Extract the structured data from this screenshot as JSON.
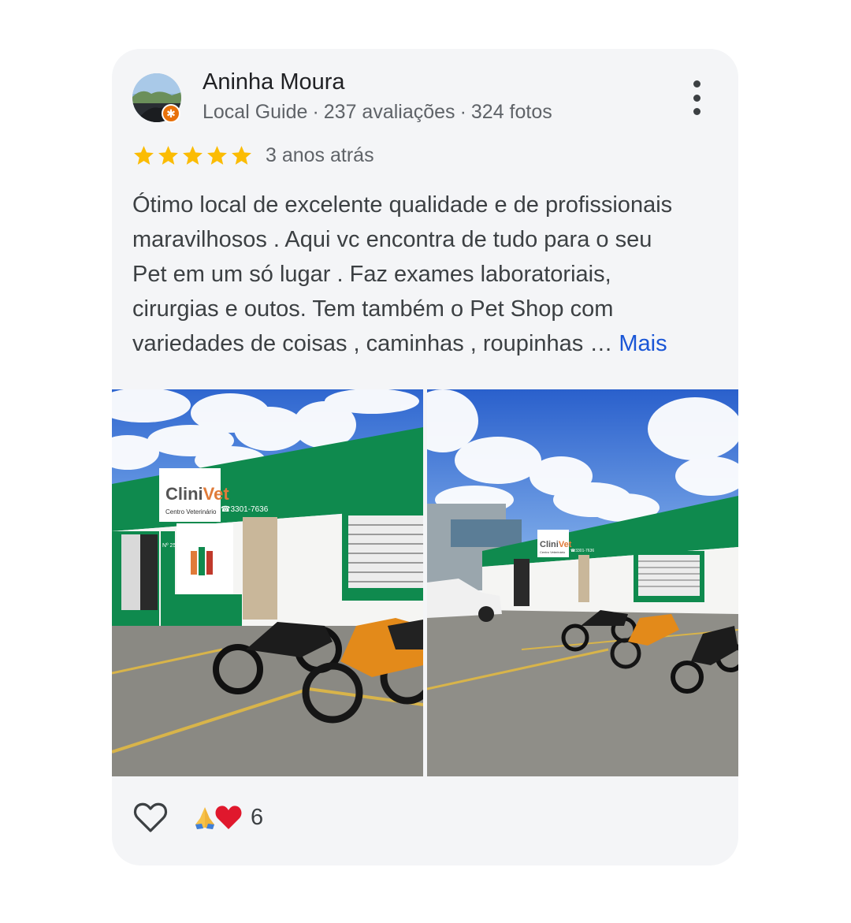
{
  "review": {
    "author": {
      "name": "Aninha Moura",
      "badge": "Local Guide",
      "reviews": "237 avaliações",
      "photos": "324 fotos",
      "avatar_icon": "avatar-photo",
      "badge_icon": "local-guide-star-icon"
    },
    "rating": 5,
    "rating_max": 5,
    "time": "3 anos atrás",
    "text_lines": [
      "Ótimo local de excelente qualidade e de profissionais",
      "maravilhosos . Aqui vc encontra de tudo para o seu",
      "Pet em um só lugar . Faz exames laboratoriais,",
      "cirurgias e outos. Tem também o Pet Shop com",
      "variedades de coisas , caminhas , roupinhas …"
    ],
    "more_label": "Mais",
    "photos_shown": [
      {
        "sign_title": "CliniVet",
        "sign_subtitle": "Centro Veterinário",
        "phone": "3301-7636",
        "number": "Nº 259"
      },
      {
        "sign_title": "CliniVet",
        "sign_subtitle": "Centro Veterinário",
        "phone": "3301-7636"
      }
    ],
    "reactions": {
      "emojis": [
        "🙏",
        "❤️"
      ],
      "count": "6"
    }
  },
  "colors": {
    "card_bg": "#f4f5f7",
    "star": "#fbbc04",
    "link": "#1a56d6",
    "guide_badge": "#e8710a",
    "building_green": "#0f8a4e",
    "sky": "#3a72d6"
  },
  "icons": [
    "more-vert-icon",
    "star-icon",
    "heart-outline-icon",
    "folded-hands-emoji",
    "red-heart-emoji"
  ]
}
